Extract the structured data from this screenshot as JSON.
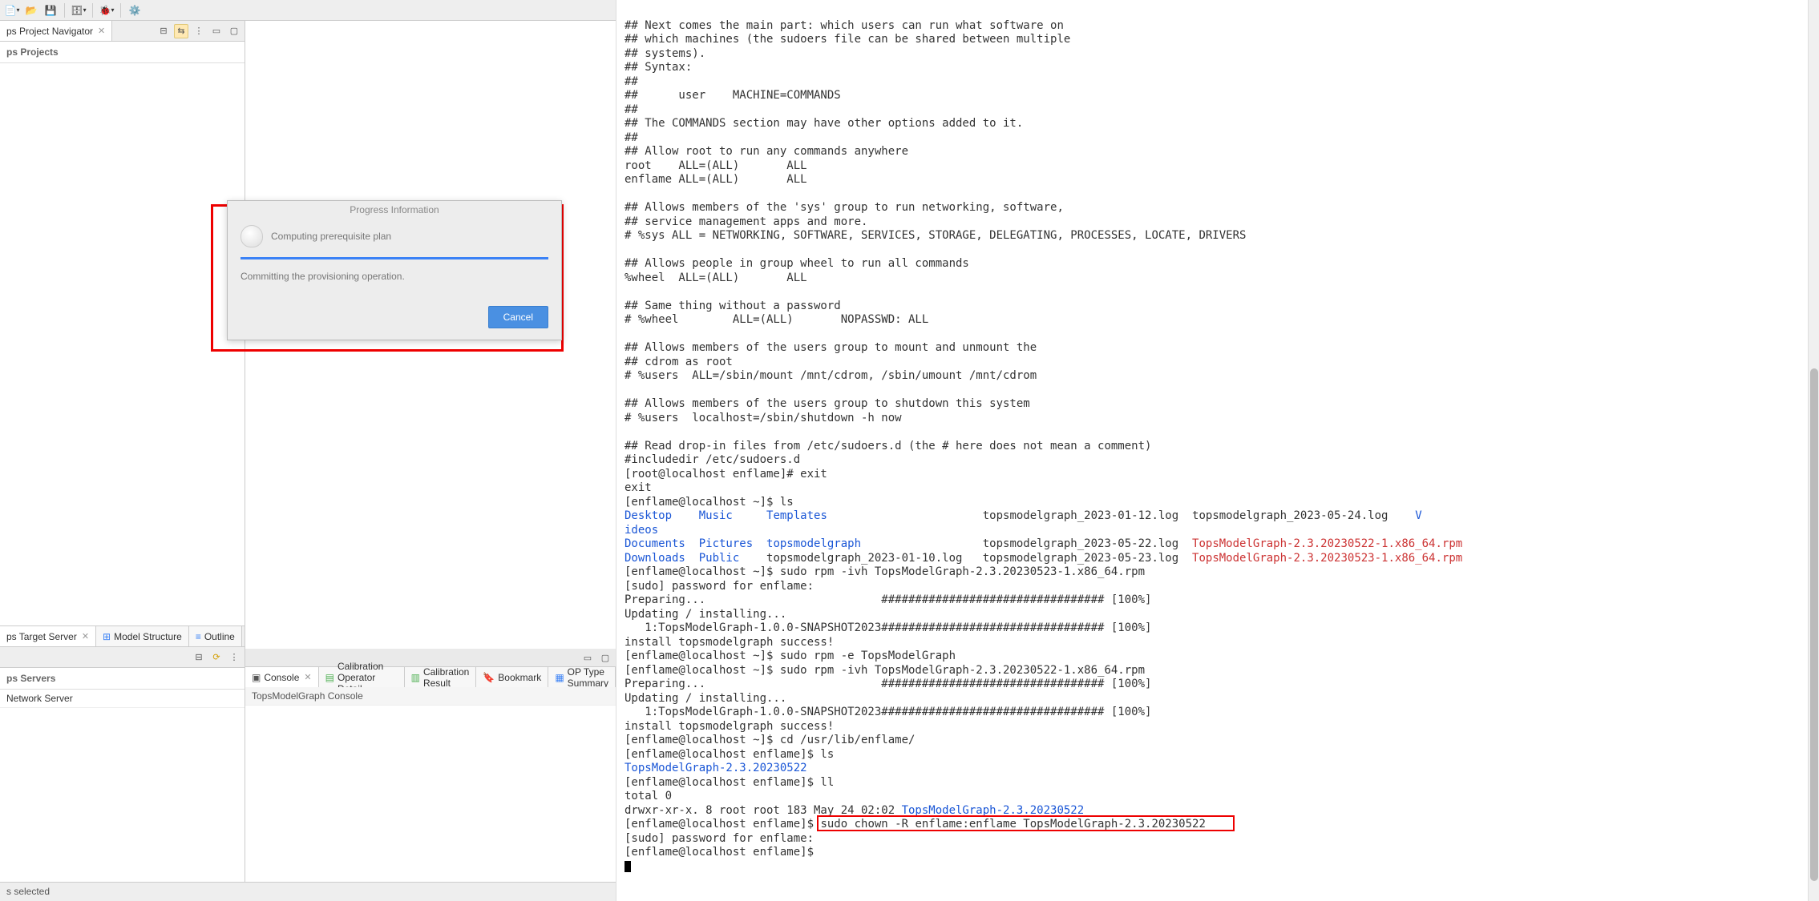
{
  "toolbar": {
    "new_label": "New",
    "open_label": "Open",
    "save_label": "Save",
    "save_all_label": "Save All",
    "db_label": "DB",
    "settings_label": "Settings",
    "debug_label": "Debug"
  },
  "navigator": {
    "tab_label": "ps Project Navigator",
    "title": "ps Projects"
  },
  "target_server": {
    "tab_label": "ps Target Server",
    "model_tab": "Model Structure",
    "outline_tab": "Outline",
    "title": "ps Servers",
    "tree_item": "Network Server"
  },
  "console": {
    "tab_label": "Console",
    "tab_calib_op": "Calibration Operator Detail",
    "tab_calib_res": "Calibration Result",
    "tab_bookmark": "Bookmark",
    "tab_optype": "OP Type Summary",
    "name": "TopsModelGraph Console"
  },
  "status": {
    "text": "s selected"
  },
  "dialog": {
    "title": "Progress Information",
    "task1": "Computing prerequisite plan",
    "task2": "Committing the provisioning operation.",
    "cancel": "Cancel"
  },
  "terminal": {
    "lines": [
      {
        "t": "## Next comes the main part: which users can run what software on"
      },
      {
        "t": "## which machines (the sudoers file can be shared between multiple"
      },
      {
        "t": "## systems)."
      },
      {
        "t": "## Syntax:"
      },
      {
        "t": "##"
      },
      {
        "t": "##      user    MACHINE=COMMANDS"
      },
      {
        "t": "##"
      },
      {
        "t": "## The COMMANDS section may have other options added to it."
      },
      {
        "t": "##"
      },
      {
        "t": "## Allow root to run any commands anywhere"
      },
      {
        "t": "root    ALL=(ALL)       ALL"
      },
      {
        "t": "enflame ALL=(ALL)       ALL"
      },
      {
        "t": ""
      },
      {
        "t": "## Allows members of the 'sys' group to run networking, software,"
      },
      {
        "t": "## service management apps and more."
      },
      {
        "t": "# %sys ALL = NETWORKING, SOFTWARE, SERVICES, STORAGE, DELEGATING, PROCESSES, LOCATE, DRIVERS"
      },
      {
        "t": ""
      },
      {
        "t": "## Allows people in group wheel to run all commands"
      },
      {
        "t": "%wheel  ALL=(ALL)       ALL"
      },
      {
        "t": ""
      },
      {
        "t": "## Same thing without a password"
      },
      {
        "t": "# %wheel        ALL=(ALL)       NOPASSWD: ALL"
      },
      {
        "t": ""
      },
      {
        "t": "## Allows members of the users group to mount and unmount the"
      },
      {
        "t": "## cdrom as root"
      },
      {
        "t": "# %users  ALL=/sbin/mount /mnt/cdrom, /sbin/umount /mnt/cdrom"
      },
      {
        "t": ""
      },
      {
        "t": "## Allows members of the users group to shutdown this system"
      },
      {
        "t": "# %users  localhost=/sbin/shutdown -h now"
      },
      {
        "t": ""
      },
      {
        "t": "## Read drop-in files from /etc/sudoers.d (the # here does not mean a comment)"
      },
      {
        "t": "#includedir /etc/sudoers.d"
      },
      {
        "t": "[root@localhost enflame]# exit"
      },
      {
        "t": "exit"
      },
      {
        "t": "[enflame@localhost ~]$ ls"
      }
    ],
    "ls1": {
      "c0": [
        "Desktop",
        "ideos",
        "Documents",
        "Downloads"
      ],
      "c1": [
        "Music",
        "",
        "Pictures",
        "Public"
      ],
      "c2": [
        "Templates",
        "",
        "topsmodelgraph",
        "topsmodelgraph_2023-01-10.log"
      ],
      "c3": [
        "topsmodelgraph_2023-01-12.log",
        "",
        "topsmodelgraph_2023-05-22.log",
        "topsmodelgraph_2023-05-23.log"
      ],
      "c4": [
        "topsmodelgraph_2023-05-24.log",
        "",
        "TopsModelGraph-2.3.20230522-1.x86_64.rpm",
        "TopsModelGraph-2.3.20230523-1.x86_64.rpm"
      ],
      "v_char": "V"
    },
    "mid": [
      "[enflame@localhost ~]$ sudo rpm -ivh TopsModelGraph-2.3.20230523-1.x86_64.rpm",
      "[sudo] password for enflame:",
      "Preparing...                          ################################# [100%]",
      "Updating / installing...",
      "   1:TopsModelGraph-1.0.0-SNAPSHOT2023################################# [100%]",
      "install topsmodelgraph success!",
      "[enflame@localhost ~]$ sudo rpm -e TopsModelGraph",
      "[enflame@localhost ~]$ sudo rpm -ivh TopsModelGraph-2.3.20230522-1.x86_64.rpm",
      "Preparing...                          ################################# [100%]",
      "Updating / installing...",
      "   1:TopsModelGraph-1.0.0-SNAPSHOT2023################################# [100%]",
      "install topsmodelgraph success!",
      "[enflame@localhost ~]$ cd /usr/lib/enflame/",
      "[enflame@localhost enflame]$ ls"
    ],
    "ls2": "TopsModelGraph-2.3.20230522",
    "post": [
      "[enflame@localhost enflame]$ ll",
      "total 0"
    ],
    "ll_line_prefix": "drwxr-xr-x. 8 root root 183 May 24 02:02 ",
    "ll_line_link": "TopsModelGraph-2.3.20230522",
    "chown_prompt": "[enflame@localhost enflame]$ ",
    "chown_cmd": "sudo chown -R enflame:enflame TopsModelGraph-2.3.20230522",
    "after_chown": [
      "[sudo] password for enflame:",
      "[enflame@localhost enflame]$ "
    ]
  }
}
